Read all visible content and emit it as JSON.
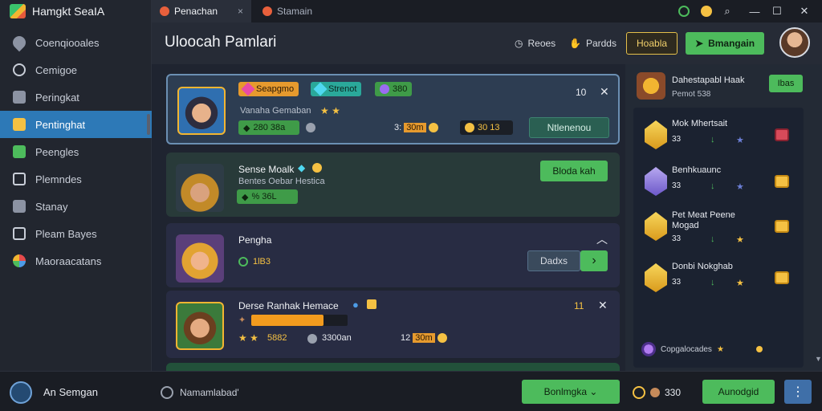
{
  "app": {
    "title": "Hamgkt SeaIA"
  },
  "sidebar": {
    "items": [
      {
        "label": "Coenqiooales",
        "icon": "location-pin-icon"
      },
      {
        "label": "Cemigoe",
        "icon": "circle-icon"
      },
      {
        "label": "Peringkat",
        "icon": "bookmark-icon"
      },
      {
        "label": "Pentinghat",
        "icon": "ticket-icon",
        "active": true
      },
      {
        "label": "Peengles",
        "icon": "cube-icon"
      },
      {
        "label": "Plemndes",
        "icon": "document-icon"
      },
      {
        "label": "Stanay",
        "icon": "checkbox-icon"
      },
      {
        "label": "Pleam Bayes",
        "icon": "d-badge-icon"
      },
      {
        "label": "Maoraacatans",
        "icon": "color-wheel-icon"
      }
    ]
  },
  "tabs": [
    {
      "label": "Penachan",
      "close": "×"
    },
    {
      "label": "Stamain"
    }
  ],
  "window": {
    "minimize": "—",
    "maximize": "☐",
    "close": "✕",
    "search": "⌕"
  },
  "header": {
    "title": "Uloocah Pamlari",
    "links": [
      {
        "label": "Reoes",
        "icon": "clock-icon"
      },
      {
        "label": "Pardds",
        "icon": "hand-icon"
      }
    ],
    "outline_button": "Hoabla",
    "primary_button": "Bmangain",
    "primary_prefix": "➤"
  },
  "cards": [
    {
      "badges": [
        "Seapgmo",
        "Strenot",
        "380"
      ],
      "subtitle": "Vanaha Gemaban",
      "stars": "★ ★",
      "stat": "280 38a",
      "amount_prefix": "3:",
      "amount": "30m",
      "gold": "30 13",
      "count": "10",
      "close": "✕",
      "action": "Ntlenenou"
    },
    {
      "title": "Sense Moalk",
      "subtitle": "Bentes Oebar Hestica",
      "stat": "% 36L",
      "action": "Bloda kah"
    },
    {
      "title": "Pengha",
      "stat": "1lB3",
      "collapse": "︿",
      "action": "Dadxs",
      "arrow": "›"
    },
    {
      "title": "Derse Ranhak Hemace",
      "count": "11",
      "close": "✕",
      "progress": 0.75,
      "stars": "★ ★",
      "stat": "5882",
      "stat2": "3300an",
      "amount_prefix": "12",
      "amount": "30m"
    }
  ],
  "panel": {
    "title": "Dahestapabl Haak",
    "subtitle": "Pemot 538",
    "button": "Ibas",
    "items": [
      {
        "title": "Mok Mhertsait",
        "count": "33",
        "arrow": "↓",
        "star": "★",
        "reward": "chest-red-icon",
        "icon": "crystal-gold-icon"
      },
      {
        "title": "Benhkuaunc",
        "count": "33",
        "arrow": "↓",
        "star": "★",
        "reward": "chest-gold-icon",
        "icon": "crystal-purple-icon"
      },
      {
        "title": "Pet Meat Peene Mogad",
        "count": "33",
        "arrow": "↓",
        "star": "★",
        "reward": "chest-gold-icon",
        "icon": "crystal-gold-icon"
      },
      {
        "title": "Donbi Nokghab",
        "count": "33",
        "arrow": "↓",
        "star": "★",
        "reward": "chest-gold-icon",
        "icon": "crystal-gold-icon"
      }
    ],
    "last": "Copgalocades"
  },
  "bottom": {
    "user": "An Semgan",
    "status": "Namamlabad'",
    "dropdown": "Bonlmgka ⌄",
    "count": "330",
    "action": "Aunodgid",
    "more": "⋮"
  },
  "colors": {
    "accent": "#2d79b7",
    "green": "#4dbb5c",
    "gold": "#f5c143"
  }
}
